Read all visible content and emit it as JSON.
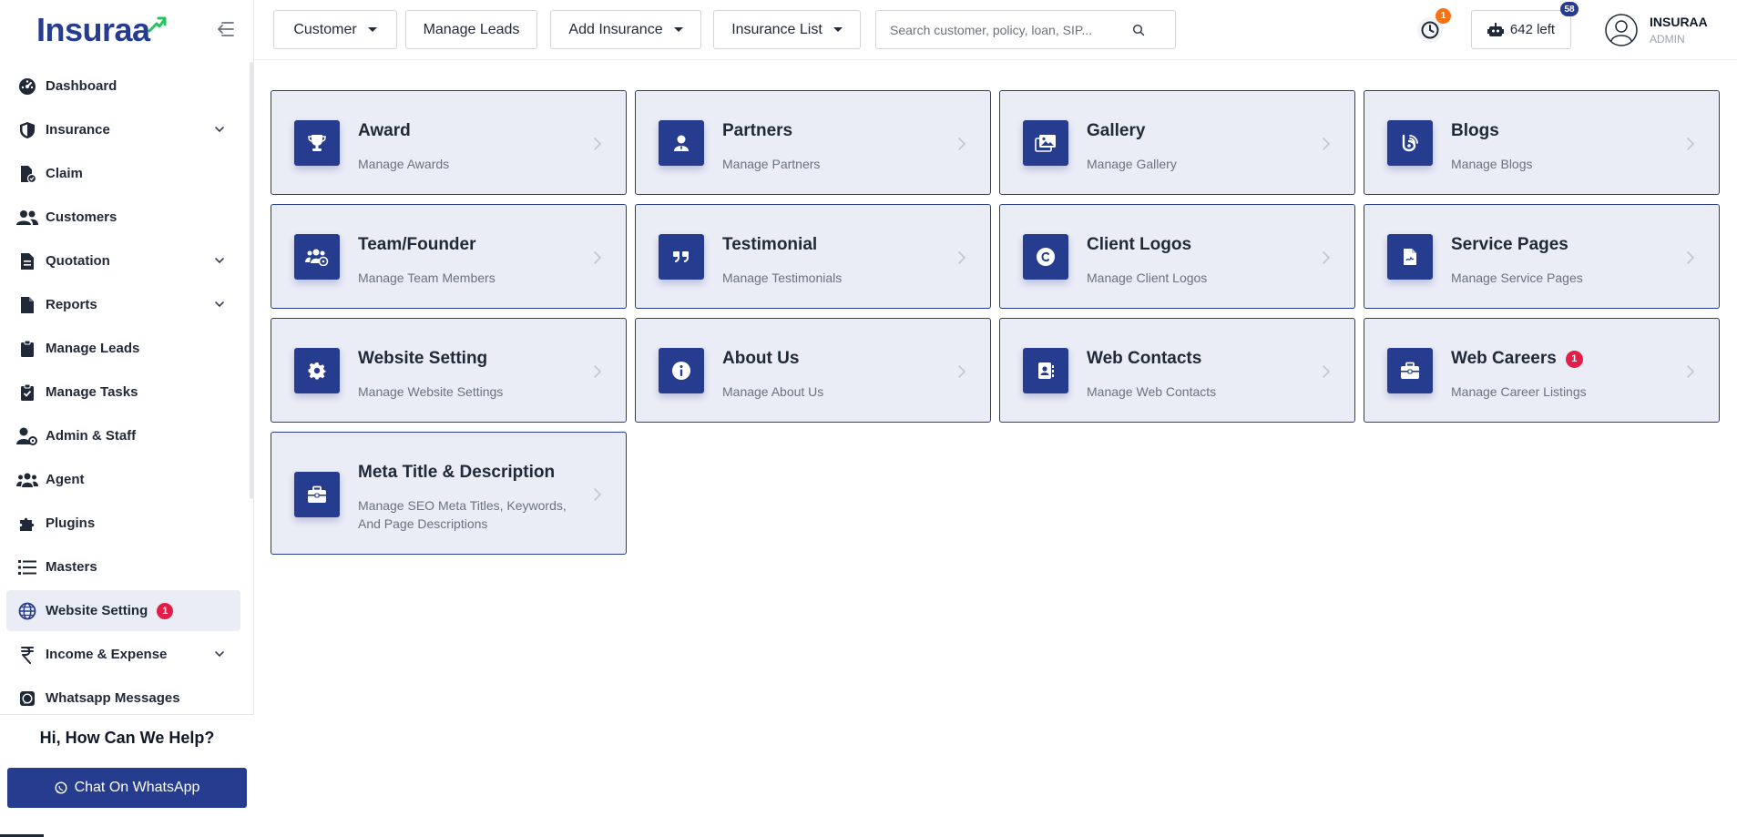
{
  "brand": {
    "logo_text": "Insuraa",
    "accent": "#263c8f",
    "logo_arrow_color": "#22c55e"
  },
  "sidebar": {
    "items": [
      {
        "label": "Dashboard",
        "icon": "dashboard-icon",
        "expandable": false
      },
      {
        "label": "Insurance",
        "icon": "shield-icon",
        "expandable": true
      },
      {
        "label": "Claim",
        "icon": "claim-file-icon",
        "expandable": false
      },
      {
        "label": "Customers",
        "icon": "users-icon",
        "expandable": false
      },
      {
        "label": "Quotation",
        "icon": "quotation-icon",
        "expandable": true
      },
      {
        "label": "Reports",
        "icon": "report-file-icon",
        "expandable": true
      },
      {
        "label": "Manage Leads",
        "icon": "clipboard-icon",
        "expandable": false
      },
      {
        "label": "Manage Tasks",
        "icon": "task-check-icon",
        "expandable": false
      },
      {
        "label": "Admin & Staff",
        "icon": "user-gear-icon",
        "expandable": false
      },
      {
        "label": "Agent",
        "icon": "agent-group-icon",
        "expandable": false
      },
      {
        "label": "Plugins",
        "icon": "puzzle-icon",
        "expandable": false
      },
      {
        "label": "Masters",
        "icon": "list-icon",
        "expandable": false
      },
      {
        "label": "Website Setting",
        "icon": "globe-icon",
        "expandable": false,
        "badge": "1",
        "active": true
      },
      {
        "label": "Income & Expense",
        "icon": "rupee-icon",
        "expandable": true
      },
      {
        "label": "Whatsapp Messages",
        "icon": "whatsapp-icon",
        "expandable": false
      }
    ],
    "help_title": "Hi, How Can We Help?",
    "whatsapp_button": "Chat On WhatsApp"
  },
  "topbar": {
    "customer": "Customer",
    "manage_leads": "Manage Leads",
    "add_insurance": "Add Insurance",
    "insurance_list": "Insurance List",
    "search_placeholder": "Search customer, policy, loan, SIP...",
    "clock_badge": "1",
    "credits_label": "642 left",
    "credits_badge": "58",
    "user_name": "INSURAA",
    "user_role": "ADMIN"
  },
  "cards": [
    {
      "title": "Award",
      "subtitle": "Manage Awards",
      "icon": "trophy-icon"
    },
    {
      "title": "Partners",
      "subtitle": "Manage Partners",
      "icon": "partner-icon"
    },
    {
      "title": "Gallery",
      "subtitle": "Manage Gallery",
      "icon": "gallery-icon"
    },
    {
      "title": "Blogs",
      "subtitle": "Manage Blogs",
      "icon": "blog-icon"
    },
    {
      "title": "Team/Founder",
      "subtitle": "Manage Team Members",
      "icon": "team-icon"
    },
    {
      "title": "Testimonial",
      "subtitle": "Manage Testimonials",
      "icon": "quote-icon"
    },
    {
      "title": "Client Logos",
      "subtitle": "Manage Client Logos",
      "icon": "copyright-icon"
    },
    {
      "title": "Service Pages",
      "subtitle": "Manage Service Pages",
      "icon": "document-icon"
    },
    {
      "title": "Website Setting",
      "subtitle": "Manage Website Settings",
      "icon": "gear-icon"
    },
    {
      "title": "About Us",
      "subtitle": "Manage About Us",
      "icon": "info-icon"
    },
    {
      "title": "Web Contacts",
      "subtitle": "Manage Web Contacts",
      "icon": "contact-book-icon"
    },
    {
      "title": "Web Careers",
      "subtitle": "Manage Career Listings",
      "icon": "briefcase-icon",
      "badge": "1"
    },
    {
      "title": "Meta Title & Description",
      "subtitle": "Manage SEO Meta Titles, Keywords, And Page Descriptions",
      "icon": "briefcase-icon"
    }
  ]
}
